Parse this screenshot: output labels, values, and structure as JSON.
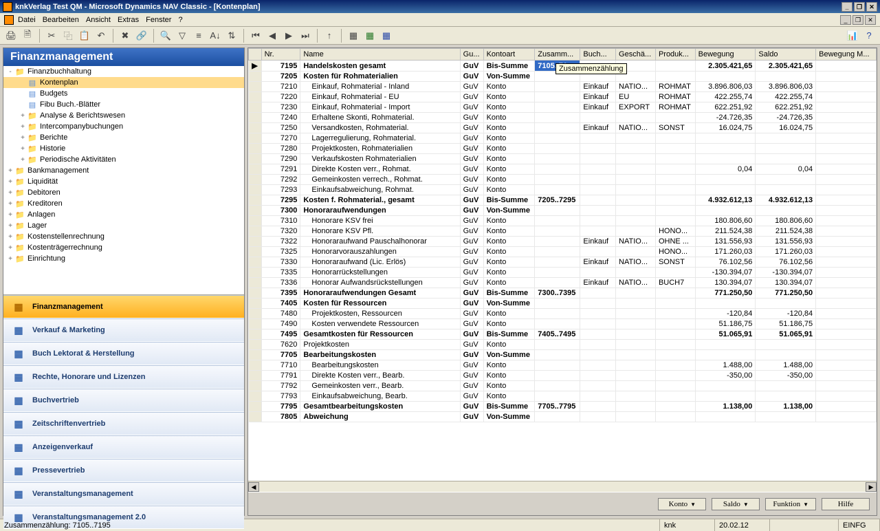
{
  "window": {
    "title": "knkVerlag Test QM - Microsoft Dynamics NAV Classic - [Kontenplan]"
  },
  "menu": {
    "items": [
      "Datei",
      "Bearbeiten",
      "Ansicht",
      "Extras",
      "Fenster",
      "?"
    ]
  },
  "nav": {
    "header": "Finanzmanagement",
    "tree": [
      {
        "level": 0,
        "expand": "-",
        "icon": "folder",
        "label": "Finanzbuchhaltung",
        "sel": false
      },
      {
        "level": 1,
        "expand": "",
        "icon": "page",
        "label": "Kontenplan",
        "sel": true
      },
      {
        "level": 1,
        "expand": "",
        "icon": "page",
        "label": "Budgets",
        "sel": false
      },
      {
        "level": 1,
        "expand": "",
        "icon": "page",
        "label": "Fibu Buch.-Blätter",
        "sel": false
      },
      {
        "level": 1,
        "expand": "+",
        "icon": "folder",
        "label": "Analyse & Berichtswesen",
        "sel": false
      },
      {
        "level": 1,
        "expand": "+",
        "icon": "folder",
        "label": "Intercompanybuchungen",
        "sel": false
      },
      {
        "level": 1,
        "expand": "+",
        "icon": "folder",
        "label": "Berichte",
        "sel": false
      },
      {
        "level": 1,
        "expand": "+",
        "icon": "folder",
        "label": "Historie",
        "sel": false
      },
      {
        "level": 1,
        "expand": "+",
        "icon": "folder",
        "label": "Periodische Aktivitäten",
        "sel": false
      },
      {
        "level": 0,
        "expand": "+",
        "icon": "folder",
        "label": "Bankmanagement",
        "sel": false
      },
      {
        "level": 0,
        "expand": "+",
        "icon": "folder",
        "label": "Liquidität",
        "sel": false
      },
      {
        "level": 0,
        "expand": "+",
        "icon": "folder",
        "label": "Debitoren",
        "sel": false
      },
      {
        "level": 0,
        "expand": "+",
        "icon": "folder",
        "label": "Kreditoren",
        "sel": false
      },
      {
        "level": 0,
        "expand": "+",
        "icon": "folder",
        "label": "Anlagen",
        "sel": false
      },
      {
        "level": 0,
        "expand": "+",
        "icon": "folder",
        "label": "Lager",
        "sel": false
      },
      {
        "level": 0,
        "expand": "+",
        "icon": "folder",
        "label": "Kostenstellenrechnung",
        "sel": false
      },
      {
        "level": 0,
        "expand": "+",
        "icon": "folder",
        "label": "Kostenträgerrechnung",
        "sel": false
      },
      {
        "level": 0,
        "expand": "+",
        "icon": "folder",
        "label": "Einrichtung",
        "sel": false
      }
    ],
    "modules": [
      {
        "label": "Finanzmanagement",
        "active": true
      },
      {
        "label": "Verkauf & Marketing",
        "active": false
      },
      {
        "label": "Buch Lektorat & Herstellung",
        "active": false
      },
      {
        "label": "Rechte, Honorare und Lizenzen",
        "active": false
      },
      {
        "label": "Buchvertrieb",
        "active": false
      },
      {
        "label": "Zeitschriftenvertrieb",
        "active": false
      },
      {
        "label": "Anzeigenverkauf",
        "active": false
      },
      {
        "label": "Pressevertrieb",
        "active": false
      },
      {
        "label": "Veranstaltungsmanagement",
        "active": false
      },
      {
        "label": "Veranstaltungsmanagement 2.0",
        "active": false
      }
    ]
  },
  "grid": {
    "columns": [
      "Nr.",
      "Name",
      "Gu...",
      "Kontoart",
      "Zusamm...",
      "Buch...",
      "Geschä...",
      "Produk...",
      "Bewegung",
      "Saldo",
      "Bewegung M..."
    ],
    "selected_cell_value": "7105..71",
    "tooltip": "Zusammenzählung",
    "rows": [
      {
        "sel": true,
        "bold": true,
        "nr": "7195",
        "name": "Handelskosten gesamt",
        "ind": 0,
        "gu": "GuV",
        "art": "Bis-Summe",
        "zus": "",
        "buch": "",
        "gesch": "",
        "prod": "",
        "bew": "2.305.421,65",
        "saldo": "2.305.421,65"
      },
      {
        "bold": true,
        "nr": "7205",
        "name": "Kosten für Rohmaterialien",
        "ind": 0,
        "gu": "GuV",
        "art": "Von-Summe",
        "zus": "",
        "buch": "",
        "gesch": "",
        "prod": "",
        "bew": "",
        "saldo": ""
      },
      {
        "nr": "7210",
        "name": "Einkauf, Rohmaterial - Inland",
        "ind": 1,
        "gu": "GuV",
        "art": "Konto",
        "zus": "",
        "buch": "Einkauf",
        "gesch": "NATIO...",
        "prod": "ROHMAT",
        "bew": "3.896.806,03",
        "saldo": "3.896.806,03"
      },
      {
        "nr": "7220",
        "name": "Einkauf, Rohmaterial - EU",
        "ind": 1,
        "gu": "GuV",
        "art": "Konto",
        "zus": "",
        "buch": "Einkauf",
        "gesch": "EU",
        "prod": "ROHMAT",
        "bew": "422.255,74",
        "saldo": "422.255,74"
      },
      {
        "nr": "7230",
        "name": "Einkauf, Rohmaterial - Import",
        "ind": 1,
        "gu": "GuV",
        "art": "Konto",
        "zus": "",
        "buch": "Einkauf",
        "gesch": "EXPORT",
        "prod": "ROHMAT",
        "bew": "622.251,92",
        "saldo": "622.251,92"
      },
      {
        "nr": "7240",
        "name": "Erhaltene Skonti, Rohmaterial.",
        "ind": 1,
        "gu": "GuV",
        "art": "Konto",
        "zus": "",
        "buch": "",
        "gesch": "",
        "prod": "",
        "bew": "-24.726,35",
        "saldo": "-24.726,35"
      },
      {
        "nr": "7250",
        "name": "Versandkosten, Rohmaterial.",
        "ind": 1,
        "gu": "GuV",
        "art": "Konto",
        "zus": "",
        "buch": "Einkauf",
        "gesch": "NATIO...",
        "prod": "SONST",
        "bew": "16.024,75",
        "saldo": "16.024,75"
      },
      {
        "nr": "7270",
        "name": "Lagerregulierung, Rohmaterial.",
        "ind": 1,
        "gu": "GuV",
        "art": "Konto",
        "zus": "",
        "buch": "",
        "gesch": "",
        "prod": "",
        "bew": "",
        "saldo": ""
      },
      {
        "nr": "7280",
        "name": "Projektkosten, Rohmaterialien",
        "ind": 1,
        "gu": "GuV",
        "art": "Konto",
        "zus": "",
        "buch": "",
        "gesch": "",
        "prod": "",
        "bew": "",
        "saldo": ""
      },
      {
        "nr": "7290",
        "name": "Verkaufskosten Rohmaterialien",
        "ind": 1,
        "gu": "GuV",
        "art": "Konto",
        "zus": "",
        "buch": "",
        "gesch": "",
        "prod": "",
        "bew": "",
        "saldo": ""
      },
      {
        "nr": "7291",
        "name": "Direkte Kosten verr., Rohmat.",
        "ind": 1,
        "gu": "GuV",
        "art": "Konto",
        "zus": "",
        "buch": "",
        "gesch": "",
        "prod": "",
        "bew": "0,04",
        "saldo": "0,04"
      },
      {
        "nr": "7292",
        "name": "Gemeinkosten verrech., Rohmat.",
        "ind": 1,
        "gu": "GuV",
        "art": "Konto",
        "zus": "",
        "buch": "",
        "gesch": "",
        "prod": "",
        "bew": "",
        "saldo": ""
      },
      {
        "nr": "7293",
        "name": "Einkaufsabweichung, Rohmat.",
        "ind": 1,
        "gu": "GuV",
        "art": "Konto",
        "zus": "",
        "buch": "",
        "gesch": "",
        "prod": "",
        "bew": "",
        "saldo": ""
      },
      {
        "bold": true,
        "nr": "7295",
        "name": "Kosten f. Rohmaterial., gesamt",
        "ind": 0,
        "gu": "GuV",
        "art": "Bis-Summe",
        "zus": "7205..7295",
        "buch": "",
        "gesch": "",
        "prod": "",
        "bew": "4.932.612,13",
        "saldo": "4.932.612,13"
      },
      {
        "bold": true,
        "nr": "7300",
        "name": "Honoraraufwendungen",
        "ind": 0,
        "gu": "GuV",
        "art": "Von-Summe",
        "zus": "",
        "buch": "",
        "gesch": "",
        "prod": "",
        "bew": "",
        "saldo": ""
      },
      {
        "nr": "7310",
        "name": "Honorare KSV frei",
        "ind": 1,
        "gu": "GuV",
        "art": "Konto",
        "zus": "",
        "buch": "",
        "gesch": "",
        "prod": "",
        "bew": "180.806,60",
        "saldo": "180.806,60"
      },
      {
        "nr": "7320",
        "name": "Honorare KSV Pfl.",
        "ind": 1,
        "gu": "GuV",
        "art": "Konto",
        "zus": "",
        "buch": "",
        "gesch": "",
        "prod": "HONO...",
        "bew": "211.524,38",
        "saldo": "211.524,38"
      },
      {
        "nr": "7322",
        "name": "Honoraraufwand Pauschalhonorar",
        "ind": 1,
        "gu": "GuV",
        "art": "Konto",
        "zus": "",
        "buch": "Einkauf",
        "gesch": "NATIO...",
        "prod": "OHNE ...",
        "bew": "131.556,93",
        "saldo": "131.556,93"
      },
      {
        "nr": "7325",
        "name": "Honorarvorauszahlungen",
        "ind": 1,
        "gu": "GuV",
        "art": "Konto",
        "zus": "",
        "buch": "",
        "gesch": "",
        "prod": "HONO...",
        "bew": "171.260,03",
        "saldo": "171.260,03"
      },
      {
        "nr": "7330",
        "name": "Honoraraufwand (Lic. Erlös)",
        "ind": 1,
        "gu": "GuV",
        "art": "Konto",
        "zus": "",
        "buch": "Einkauf",
        "gesch": "NATIO...",
        "prod": "SONST",
        "bew": "76.102,56",
        "saldo": "76.102,56"
      },
      {
        "nr": "7335",
        "name": "Honorarrückstellungen",
        "ind": 1,
        "gu": "GuV",
        "art": "Konto",
        "zus": "",
        "buch": "",
        "gesch": "",
        "prod": "",
        "bew": "-130.394,07",
        "saldo": "-130.394,07"
      },
      {
        "nr": "7336",
        "name": "Honorar Aufwandsrückstellungen",
        "ind": 1,
        "gu": "GuV",
        "art": "Konto",
        "zus": "",
        "buch": "Einkauf",
        "gesch": "NATIO...",
        "prod": "BUCH7",
        "bew": "130.394,07",
        "saldo": "130.394,07"
      },
      {
        "bold": true,
        "nr": "7395",
        "name": "Honoraraufwendungen Gesamt",
        "ind": 0,
        "gu": "GuV",
        "art": "Bis-Summe",
        "zus": "7300..7395",
        "buch": "",
        "gesch": "",
        "prod": "",
        "bew": "771.250,50",
        "saldo": "771.250,50"
      },
      {
        "bold": true,
        "nr": "7405",
        "name": "Kosten für Ressourcen",
        "ind": 0,
        "gu": "GuV",
        "art": "Von-Summe",
        "zus": "",
        "buch": "",
        "gesch": "",
        "prod": "",
        "bew": "",
        "saldo": ""
      },
      {
        "nr": "7480",
        "name": "Projektkosten, Ressourcen",
        "ind": 1,
        "gu": "GuV",
        "art": "Konto",
        "zus": "",
        "buch": "",
        "gesch": "",
        "prod": "",
        "bew": "-120,84",
        "saldo": "-120,84"
      },
      {
        "nr": "7490",
        "name": "Kosten verwendete Ressourcen",
        "ind": 1,
        "gu": "GuV",
        "art": "Konto",
        "zus": "",
        "buch": "",
        "gesch": "",
        "prod": "",
        "bew": "51.186,75",
        "saldo": "51.186,75"
      },
      {
        "bold": true,
        "nr": "7495",
        "name": "Gesamtkosten für Ressourcen",
        "ind": 0,
        "gu": "GuV",
        "art": "Bis-Summe",
        "zus": "7405..7495",
        "buch": "",
        "gesch": "",
        "prod": "",
        "bew": "51.065,91",
        "saldo": "51.065,91"
      },
      {
        "nr": "7620",
        "name": "Projektkosten",
        "ind": 0,
        "gu": "GuV",
        "art": "Konto",
        "zus": "",
        "buch": "",
        "gesch": "",
        "prod": "",
        "bew": "",
        "saldo": ""
      },
      {
        "bold": true,
        "nr": "7705",
        "name": "Bearbeitungskosten",
        "ind": 0,
        "gu": "GuV",
        "art": "Von-Summe",
        "zus": "",
        "buch": "",
        "gesch": "",
        "prod": "",
        "bew": "",
        "saldo": ""
      },
      {
        "nr": "7710",
        "name": "Bearbeitungskosten",
        "ind": 1,
        "gu": "GuV",
        "art": "Konto",
        "zus": "",
        "buch": "",
        "gesch": "",
        "prod": "",
        "bew": "1.488,00",
        "saldo": "1.488,00"
      },
      {
        "nr": "7791",
        "name": "Direkte Kosten verr., Bearb.",
        "ind": 1,
        "gu": "GuV",
        "art": "Konto",
        "zus": "",
        "buch": "",
        "gesch": "",
        "prod": "",
        "bew": "-350,00",
        "saldo": "-350,00"
      },
      {
        "nr": "7792",
        "name": "Gemeinkosten verr., Bearb.",
        "ind": 1,
        "gu": "GuV",
        "art": "Konto",
        "zus": "",
        "buch": "",
        "gesch": "",
        "prod": "",
        "bew": "",
        "saldo": ""
      },
      {
        "nr": "7793",
        "name": "Einkaufsabweichung, Bearb.",
        "ind": 1,
        "gu": "GuV",
        "art": "Konto",
        "zus": "",
        "buch": "",
        "gesch": "",
        "prod": "",
        "bew": "",
        "saldo": ""
      },
      {
        "bold": true,
        "nr": "7795",
        "name": "Gesamtbearbeitungskosten",
        "ind": 0,
        "gu": "GuV",
        "art": "Bis-Summe",
        "zus": "7705..7795",
        "buch": "",
        "gesch": "",
        "prod": "",
        "bew": "1.138,00",
        "saldo": "1.138,00"
      },
      {
        "bold": true,
        "nr": "7805",
        "name": "Abweichung",
        "ind": 0,
        "gu": "GuV",
        "art": "Von-Summe",
        "zus": "",
        "buch": "",
        "gesch": "",
        "prod": "",
        "bew": "",
        "saldo": ""
      }
    ]
  },
  "buttons": {
    "konto": "Konto",
    "saldo": "Saldo",
    "funktion": "Funktion",
    "hilfe": "Hilfe"
  },
  "status": {
    "text": "Zusammenzählung: 7105..7195",
    "user": "knk",
    "date": "20.02.12",
    "mode": "EINFG"
  }
}
